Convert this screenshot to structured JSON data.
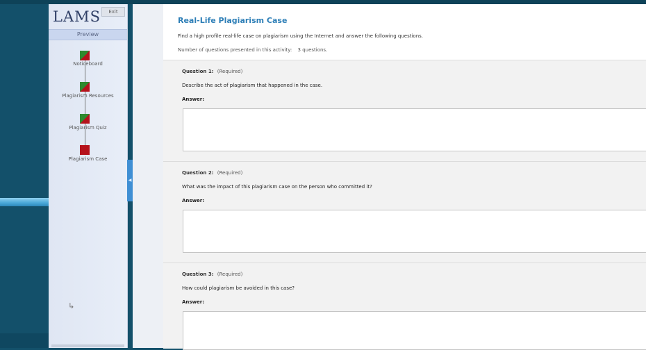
{
  "sidebar": {
    "logo": "LAMS",
    "exit_label": "Exit",
    "preview_label": "Preview",
    "activities": [
      {
        "label": "Noticeboard",
        "state": "done"
      },
      {
        "label": "Plagiarism Resources",
        "state": "done"
      },
      {
        "label": "Plagiarism Quiz",
        "state": "done"
      },
      {
        "label": "Plagiarism Case",
        "state": "current"
      }
    ]
  },
  "main": {
    "title": "Real-Life Plagiarism Case",
    "intro": "Find a high profile real-life case on plagiarism using the Internet and answer the following questions.",
    "count_label": "Number of questions presented in this activity:",
    "count_value": "3 questions.",
    "questions": [
      {
        "number": "Question 1:",
        "required": "(Required)",
        "text": "Describe the act of plagiarism that happened in the case.",
        "answer_label": "Answer:",
        "answer_value": ""
      },
      {
        "number": "Question 2:",
        "required": "(Required)",
        "text": "What was the impact of this plagiarism case on the person who committed it?",
        "answer_label": "Answer:",
        "answer_value": ""
      },
      {
        "number": "Question 3:",
        "required": "(Required)",
        "text": "How could plagiarism be avoided in this case?",
        "answer_label": "Answer:",
        "answer_value": ""
      }
    ]
  },
  "colors": {
    "background": "#13506a",
    "title": "#2e7fb7",
    "node_done_green": "#2e8a2e",
    "node_red": "#b5121b",
    "handle": "#3f8fd4"
  }
}
